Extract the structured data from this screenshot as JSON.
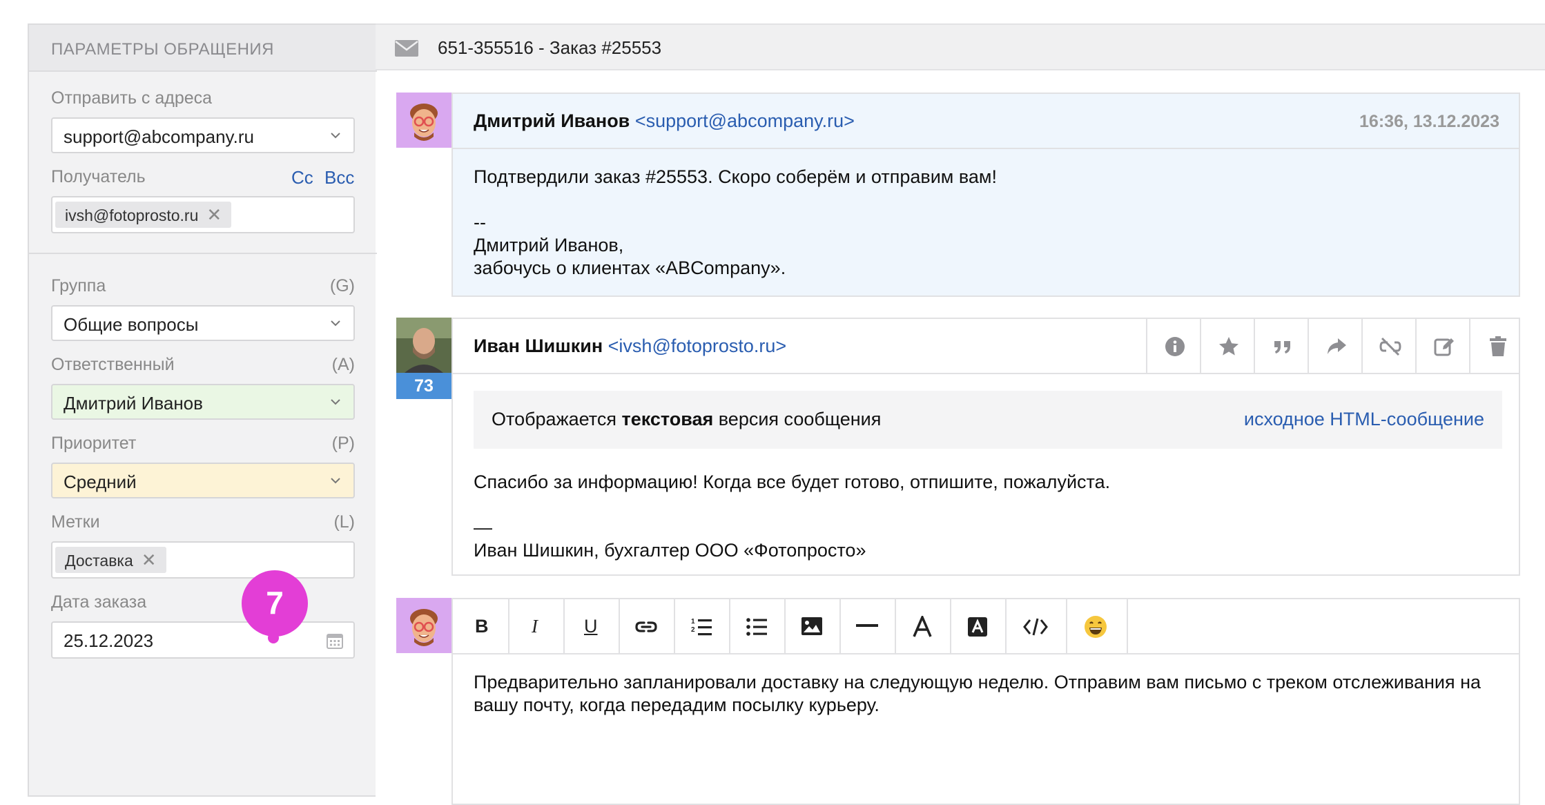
{
  "sidebar": {
    "header": "ПАРАМЕТРЫ ОБРАЩЕНИЯ",
    "from_label": "Отправить с адреса",
    "from_value": "support@abcompany.ru",
    "recipient_label": "Получатель",
    "cc": "Cc",
    "bcc": "Bcc",
    "recipient_chip": "ivsh@fotoprosto.ru",
    "group_label": "Группа",
    "group_hotkey": "(G)",
    "group_value": "Общие вопросы",
    "assignee_label": "Ответственный",
    "assignee_hotkey": "(A)",
    "assignee_value": "Дмитрий Иванов",
    "priority_label": "Приоритет",
    "priority_hotkey": "(P)",
    "priority_value": "Средний",
    "tags_label": "Метки",
    "tags_hotkey": "(L)",
    "tag_chip": "Доставка",
    "order_date_label": "Дата заказа",
    "order_date_value": "25.12.2023",
    "badge": "7"
  },
  "ticket": {
    "title": "651-355516 - Заказ #25553"
  },
  "messages": [
    {
      "sender_name": "Дмитрий Иванов",
      "sender_email": "<support@abcompany.ru>",
      "time": "16:36, 13.12.2023",
      "lines": [
        "Подтвердили заказ #25553. Скоро соберём и отправим вам!",
        "",
        "--",
        "Дмитрий Иванов,",
        "забочусь о клиентах «ABCompany»."
      ]
    },
    {
      "sender_name": "Иван Шишкин",
      "sender_email": "<ivsh@fotoprosto.ru>",
      "avatar_count": "73",
      "notice_prefix": "Отображается ",
      "notice_bold": "текстовая",
      "notice_suffix": " версия сообщения",
      "html_link": "исходное HTML-сообщение",
      "lines": [
        "Спасибо за информацию! Когда все будет готово, отпишите, пожалуйста.",
        "",
        "—",
        "Иван Шишкин, бухгалтер ООО «Фотопросто»"
      ]
    }
  ],
  "editor": {
    "bold": "B",
    "italic": "I",
    "underline": "U",
    "text": "Предварительно запланировали доставку на следующую неделю. Отправим вам письмо с треком отслеживания на вашу почту, когда передадим посылку курьеру."
  },
  "colors": {
    "link": "#2a5db0",
    "assignee_bg": "#eaf7e4",
    "priority_bg": "#fdf3d6",
    "agent_avatar_bg": "#d9a8f0",
    "badge": "#e33ed6",
    "count_badge": "#4a90d9"
  }
}
